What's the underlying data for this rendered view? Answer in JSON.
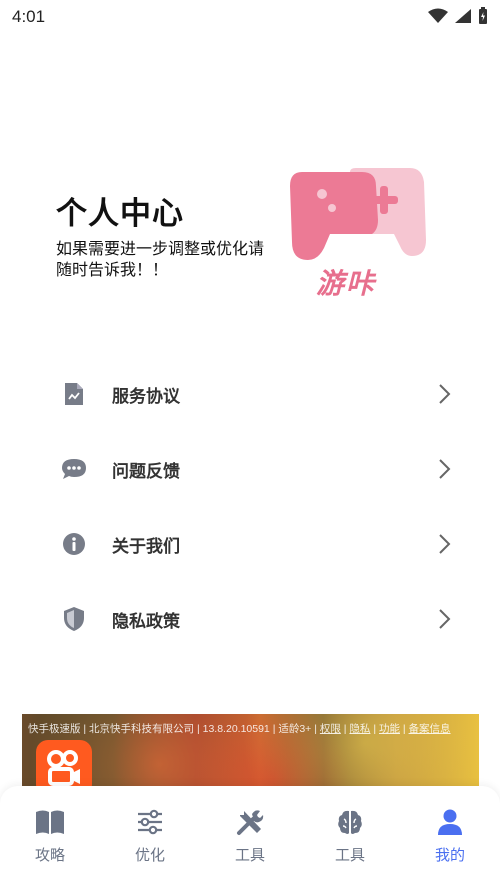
{
  "status_bar": {
    "time": "4:01"
  },
  "header": {
    "title": "个人中心",
    "subtitle": "如果需要进一步调整或优化请随时告诉我！！",
    "logo_text": "游咔"
  },
  "menu": [
    {
      "label": "服务协议",
      "icon": "document-icon"
    },
    {
      "label": "问题反馈",
      "icon": "chat-bubble-icon"
    },
    {
      "label": "关于我们",
      "icon": "info-icon"
    },
    {
      "label": "隐私政策",
      "icon": "shield-icon"
    }
  ],
  "ad": {
    "caption_prefix": "快手极速版 | 北京快手科技有限公司 | 13.8.20.10591 | 适龄3+ | ",
    "links": [
      "权限",
      "隐私",
      "功能",
      "备案信息"
    ]
  },
  "tabs": [
    {
      "label": "攻略",
      "icon": "book-icon",
      "active": false
    },
    {
      "label": "优化",
      "icon": "sliders-icon",
      "active": false
    },
    {
      "label": "工具",
      "icon": "tools-icon",
      "active": false
    },
    {
      "label": "工具",
      "icon": "brain-icon",
      "active": false
    },
    {
      "label": "我的",
      "icon": "user-icon",
      "active": true
    }
  ],
  "colors": {
    "accent": "#4a6ff0",
    "tab_inactive": "#6b7486",
    "logo_pink": "#ec7a95",
    "logo_light_pink": "#f6c6d2",
    "menu_icon": "#777c88"
  }
}
